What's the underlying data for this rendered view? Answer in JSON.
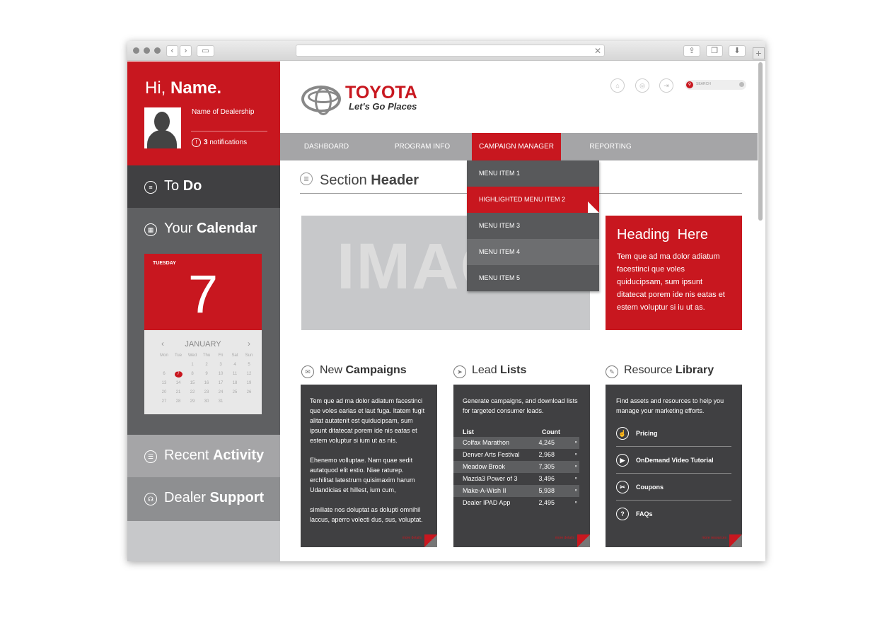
{
  "user": {
    "greeting": "Hi,",
    "name": "Name.",
    "dealership": "Name of Dealership",
    "notif_count": "3",
    "notif_label": " notifications"
  },
  "sidebar": {
    "todo": {
      "light": "To ",
      "bold": "Do"
    },
    "calendar": {
      "light": "Your ",
      "bold": "Calendar"
    },
    "activity": {
      "light": "Recent ",
      "bold": "Activity"
    },
    "support": {
      "light": "Dealer ",
      "bold": "Support"
    }
  },
  "calendar": {
    "weekday": "TUESDAY",
    "day": "7",
    "month": "JANUARY",
    "day_headers": [
      "Mon",
      "Tue",
      "Wed",
      "Thu",
      "Fri",
      "Sat",
      "Sun"
    ],
    "cells": [
      "",
      "",
      "1",
      "2",
      "3",
      "4",
      "5",
      "6",
      "7",
      "8",
      "9",
      "10",
      "11",
      "12",
      "13",
      "14",
      "15",
      "16",
      "17",
      "18",
      "19",
      "20",
      "21",
      "22",
      "23",
      "24",
      "25",
      "26",
      "27",
      "28",
      "29",
      "30",
      "31",
      "",
      ""
    ],
    "selected": "7"
  },
  "brand": {
    "name": "TOYOTA",
    "tagline": "Let's Go Places"
  },
  "search": {
    "placeholder": "SEARCH"
  },
  "nav": {
    "items": [
      "DASHBOARD",
      "PROGRAM INFO",
      "CAMPAIGN MANAGER",
      "REPORTING"
    ],
    "active": "CAMPAIGN MANAGER"
  },
  "dropdown": {
    "items": [
      "MENU ITEM 1",
      "HIGHLIGHTED MENU ITEM 2",
      "MENU ITEM 3",
      "MENU ITEM 4",
      "MENU ITEM 5"
    ]
  },
  "section": {
    "light": "Section ",
    "bold": "Header"
  },
  "image_placeholder": "IMAGE",
  "heading_box": {
    "title": "Heading  Here",
    "body": "Tem que ad ma dolor adiatum facestinci que voles quiducipsam, sum ipsunt ditatecat porem ide nis eatas et estem voluptur si iu ut as."
  },
  "campaigns": {
    "title_light": "New ",
    "title_bold": "Campaigns",
    "p1": "Tem que ad ma dolor adiatum facestinci que voles earias et laut fuga. Itatem fugit alitat autatenit est quiducipsam, sum ipsunt ditatecat porem ide nis eatas et estem voluptur si ium ut as nis.",
    "p2": "Ehenemo volluptae. Nam quae sedit autatquod elit estio. Niae raturep. erchilitat latestrum quisimaxim harum Udandicias et hillest, ium cum,",
    "p3": "similiate nos doluptat as dolupti omnihil laccus, aperro volecti dus, sus, voluptat.",
    "more": "more details"
  },
  "leads": {
    "title_light": "Lead ",
    "title_bold": "Lists",
    "intro": "Generate campaigns, and download lists for targeted consumer leads.",
    "col_list": "List",
    "col_count": "Count",
    "rows": [
      {
        "name": "Colfax Marathon",
        "count": "4,245"
      },
      {
        "name": "Denver Arts Festival",
        "count": "2,968"
      },
      {
        "name": "Meadow Brook",
        "count": "7,305"
      },
      {
        "name": "Mazda3 Power of 3",
        "count": "3,496"
      },
      {
        "name": "Make-A-Wish II",
        "count": "5,938"
      },
      {
        "name": "Dealer IPAD App",
        "count": "2,495"
      }
    ],
    "more": "more details"
  },
  "resources": {
    "title_light": "Resource ",
    "title_bold": "Library",
    "intro": "Find assets and resources to help you manage your marketing efforts.",
    "items": [
      "Pricing",
      "OnDemand Video Tutorial",
      "Coupons",
      "FAQs"
    ],
    "more": "more resources"
  },
  "colors": {
    "brand_red": "#c8171f",
    "dark": "#404042",
    "mid_gray": "#5f6062",
    "nav_gray": "#a5a5a7"
  }
}
